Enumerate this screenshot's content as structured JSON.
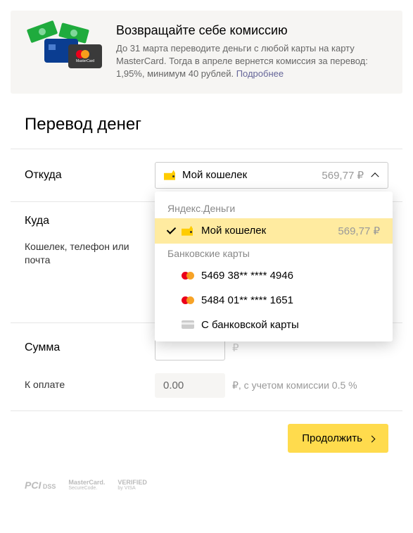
{
  "promo": {
    "title": "Возвращайте себе комиссию",
    "description": "До 31 марта переводите деньги с любой карты на карту MasterCard. Тогда в апреле вернется комиссия за перевод: 1,95%, минимум 40 рублей. ",
    "link_text": "Подробнее"
  },
  "page": {
    "title": "Перевод денег"
  },
  "from": {
    "label": "Откуда",
    "selected_name": "Мой кошелек",
    "selected_balance": "569,77 ₽"
  },
  "dropdown": {
    "group1_title": "Яндекс.Деньги",
    "wallet": {
      "name": "Мой кошелек",
      "balance": "569,77 ₽"
    },
    "group2_title": "Банковские карты",
    "card1": "5469 38** **** 4946",
    "card2": "5484 01** **** 1651",
    "any_card": "С банковской карты"
  },
  "to": {
    "label": "Куда",
    "sublabel": "Кошелек, телефон или почта"
  },
  "amount": {
    "label": "Сумма",
    "currency": "₽"
  },
  "total": {
    "label": "К оплате",
    "value": "0.00",
    "hint": "₽, с учетом комиссии 0.5 %"
  },
  "buttons": {
    "continue": "Продолжить"
  },
  "security": {
    "pci1": "PCI",
    "pci2": "DSS",
    "mc1": "MasterCard.",
    "mc2": "SecureCode.",
    "visa1": "VERIFIED",
    "visa2": "by VISA"
  }
}
